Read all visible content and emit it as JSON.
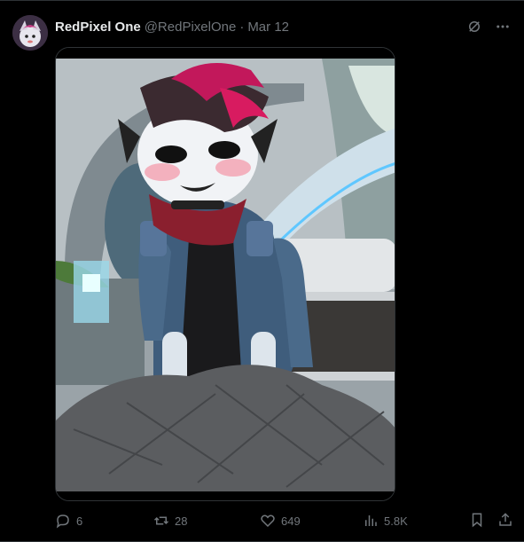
{
  "post": {
    "display_name": "RedPixel One",
    "handle": "@RedPixelOne",
    "separator": "·",
    "date": "Mar 12"
  },
  "actions": {
    "replies": "6",
    "reposts": "28",
    "likes": "649",
    "views": "5.8K"
  },
  "icons": {
    "grok": "grok-icon",
    "more": "more-icon",
    "reply": "reply-icon",
    "repost": "repost-icon",
    "like": "heart-icon",
    "views": "views-icon",
    "bookmark": "bookmark-icon",
    "share": "share-icon"
  },
  "colors": {
    "background": "#000000",
    "text_primary": "#e7e9ea",
    "text_secondary": "#71767b",
    "border": "#2f3336"
  }
}
